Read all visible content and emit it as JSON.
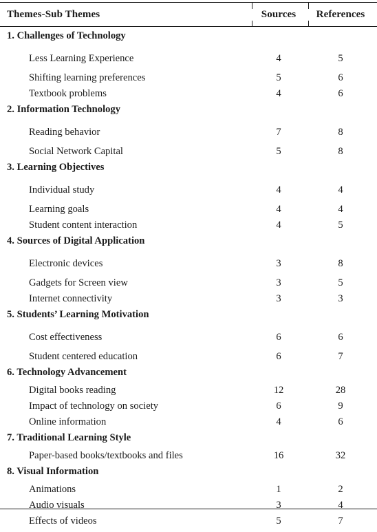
{
  "document": {
    "clipped_line_above": "",
    "columns": {
      "label": "Themes-Sub Themes",
      "sources": "Sources",
      "references": "References"
    }
  },
  "table": {
    "rows": [
      {
        "type": "theme",
        "label": "1. Challenges of Technology",
        "sources": "",
        "references": ""
      },
      {
        "type": "sub",
        "label": "Less Learning Experience",
        "sources": "4",
        "references": "5"
      },
      {
        "type": "sub",
        "label": "Shifting learning preferences",
        "sources": "5",
        "references": "6"
      },
      {
        "type": "sub",
        "label": "Textbook problems",
        "sources": "4",
        "references": "6"
      },
      {
        "type": "theme",
        "label": "2. Information Technology",
        "sources": "",
        "references": ""
      },
      {
        "type": "sub",
        "label": "Reading behavior",
        "sources": "7",
        "references": "8"
      },
      {
        "type": "sub",
        "label": "Social Network Capital",
        "sources": "5",
        "references": "8"
      },
      {
        "type": "theme",
        "label": "3. Learning Objectives",
        "sources": "",
        "references": ""
      },
      {
        "type": "sub",
        "label": "Individual study",
        "sources": "4",
        "references": "4"
      },
      {
        "type": "sub",
        "label": "Learning goals",
        "sources": "4",
        "references": "4"
      },
      {
        "type": "sub",
        "label": "Student content interaction",
        "sources": "4",
        "references": "5"
      },
      {
        "type": "theme",
        "label": "4. Sources of Digital Application",
        "sources": "",
        "references": ""
      },
      {
        "type": "sub",
        "label": "Electronic devices",
        "sources": "3",
        "references": "8"
      },
      {
        "type": "sub",
        "label": "Gadgets for Screen view",
        "sources": "3",
        "references": "5"
      },
      {
        "type": "sub",
        "label": "Internet connectivity",
        "sources": "3",
        "references": "3"
      },
      {
        "type": "theme",
        "label": "5. Students’ Learning Motivation",
        "sources": "",
        "references": ""
      },
      {
        "type": "sub",
        "label": "Cost effectiveness",
        "sources": "6",
        "references": "6"
      },
      {
        "type": "sub",
        "label": "Student centered education",
        "sources": "6",
        "references": "7"
      },
      {
        "type": "theme",
        "label": "6. Technology Advancement",
        "sources": "",
        "references": ""
      },
      {
        "type": "sub",
        "label": "Digital books reading",
        "sources": "12",
        "references": "28"
      },
      {
        "type": "sub",
        "label": "Impact of technology on society",
        "sources": "6",
        "references": "9"
      },
      {
        "type": "sub",
        "label": "Online information",
        "sources": "4",
        "references": "6"
      },
      {
        "type": "theme",
        "label": "7. Traditional Learning Style",
        "sources": "",
        "references": ""
      },
      {
        "type": "sub",
        "label": "Paper-based books/textbooks and files",
        "sources": "16",
        "references": "32"
      },
      {
        "type": "theme",
        "label": "8. Visual Information",
        "sources": "",
        "references": ""
      },
      {
        "type": "sub",
        "label": "Animations",
        "sources": "1",
        "references": "2"
      },
      {
        "type": "sub",
        "label": "Audio visuals",
        "sources": "3",
        "references": "4"
      },
      {
        "type": "sub",
        "label": "Effects of videos",
        "sources": "5",
        "references": "7"
      }
    ]
  }
}
